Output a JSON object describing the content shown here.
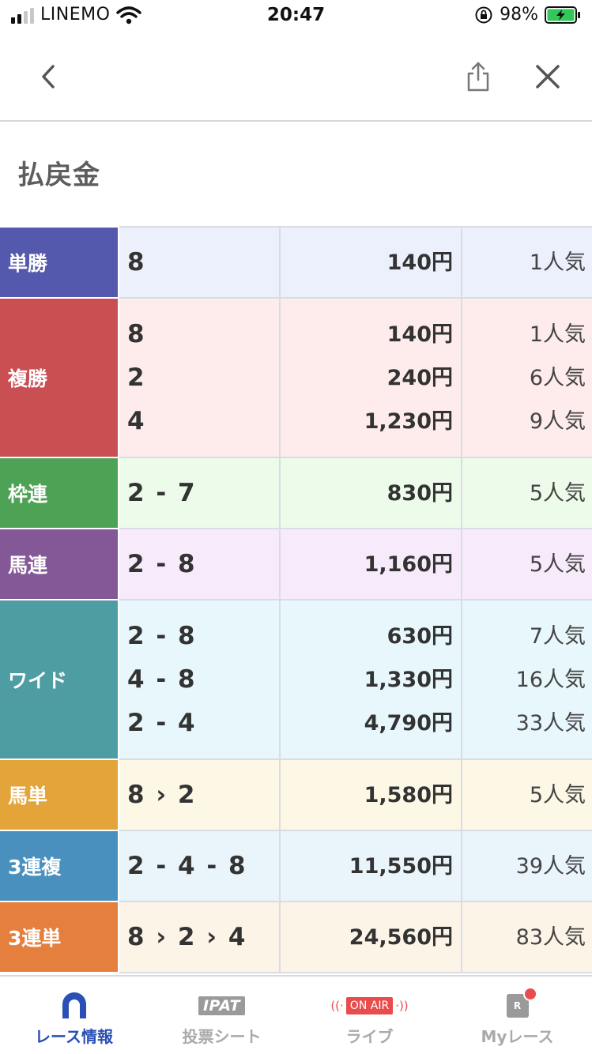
{
  "status_bar": {
    "carrier": "LINEMO",
    "time": "20:47",
    "battery_percent": "98%"
  },
  "page_title": "払戻金",
  "payouts": [
    {
      "type": "単勝",
      "color": "#5459ad",
      "row_bg": "#ebf0fc",
      "entries": [
        {
          "combo": "8",
          "amount": "140円",
          "popularity": "1人気"
        }
      ]
    },
    {
      "type": "複勝",
      "color": "#c94f52",
      "row_bg": "#fdeceb",
      "entries": [
        {
          "combo": "8",
          "amount": "140円",
          "popularity": "1人気"
        },
        {
          "combo": "2",
          "amount": "240円",
          "popularity": "6人気"
        },
        {
          "combo": "4",
          "amount": "1,230円",
          "popularity": "9人気"
        }
      ]
    },
    {
      "type": "枠連",
      "color": "#4ea256",
      "row_bg": "#edfbea",
      "entries": [
        {
          "combo": "2 - 7",
          "amount": "830円",
          "popularity": "5人気"
        }
      ]
    },
    {
      "type": "馬連",
      "color": "#845897",
      "row_bg": "#f7ebfb",
      "entries": [
        {
          "combo": "2 - 8",
          "amount": "1,160円",
          "popularity": "5人気"
        }
      ]
    },
    {
      "type": "ワイド",
      "color": "#4e9da2",
      "row_bg": "#e8f7fb",
      "entries": [
        {
          "combo": "2 - 8",
          "amount": "630円",
          "popularity": "7人気"
        },
        {
          "combo": "4 - 8",
          "amount": "1,330円",
          "popularity": "16人気"
        },
        {
          "combo": "2 - 4",
          "amount": "4,790円",
          "popularity": "33人気"
        }
      ]
    },
    {
      "type": "馬単",
      "color": "#e3a53a",
      "row_bg": "#fdf8e6",
      "entries": [
        {
          "combo": "8 › 2",
          "amount": "1,580円",
          "popularity": "5人気"
        }
      ]
    },
    {
      "type": "3連複",
      "color": "#4a90bf",
      "row_bg": "#eaf4fb",
      "entries": [
        {
          "combo": "2 - 4 - 8",
          "amount": "11,550円",
          "popularity": "39人気"
        }
      ]
    },
    {
      "type": "3連単",
      "color": "#e57f3e",
      "row_bg": "#fdf4e8",
      "entries": [
        {
          "combo": "8 › 2 › 4",
          "amount": "24,560円",
          "popularity": "83人気"
        }
      ]
    }
  ],
  "tabs": [
    {
      "label": "レース情報",
      "icon": "horseshoe-icon",
      "active": true
    },
    {
      "label": "投票シート",
      "icon": "ipat-icon",
      "badge_text": "IPAT",
      "active": false
    },
    {
      "label": "ライブ",
      "icon": "on-air-icon",
      "badge_text": "ON AIR",
      "active": false
    },
    {
      "label": "Myレース",
      "icon": "my-race-icon",
      "badge_text": "R",
      "active": false
    }
  ]
}
